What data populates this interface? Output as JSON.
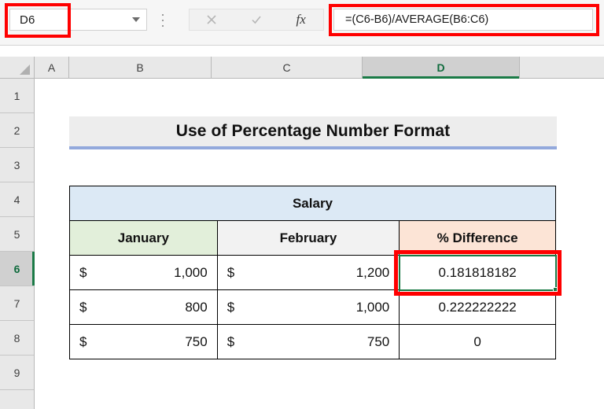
{
  "app": "excel-worksheet",
  "formula_bar": {
    "name_box_value": "D6",
    "name_box_dropdown_icon": "chevron-down-icon",
    "cancel_icon": "cancel-x-icon",
    "confirm_icon": "confirm-check-icon",
    "function_icon": "fx-insert-function-icon",
    "formula_value": "=(C6-B6)/AVERAGE(B6:C6)",
    "formula_placeholder": ""
  },
  "grid": {
    "columns": [
      "A",
      "B",
      "C",
      "D"
    ],
    "selected_column": "D",
    "rows": [
      "1",
      "2",
      "3",
      "4",
      "5",
      "6",
      "7",
      "8",
      "9"
    ],
    "selected_row": "6",
    "corner_select_all_icon": "select-all-triangle-icon"
  },
  "sheet": {
    "title": "Use of Percentage Number Format",
    "table": {
      "group_header": "Salary",
      "headers": [
        "January",
        "February",
        "% Difference"
      ],
      "rows": [
        {
          "january_symbol": "$",
          "january_value": "1,000",
          "february_symbol": "$",
          "february_value": "1,200",
          "difference": "0.181818182"
        },
        {
          "january_symbol": "$",
          "january_value": "800",
          "february_symbol": "$",
          "february_value": "1,000",
          "difference": "0.222222222"
        },
        {
          "january_symbol": "$",
          "january_value": "750",
          "february_symbol": "$",
          "february_value": "750",
          "difference": "0"
        }
      ]
    }
  },
  "colors": {
    "annotation": "#ff0000",
    "selection": "#1a7a46",
    "salary_header": "#dce9f5",
    "january_header": "#e2efda",
    "february_header": "#f2f2f2",
    "percent_header": "#fce4d6",
    "title_underline": "#93a9dc"
  }
}
